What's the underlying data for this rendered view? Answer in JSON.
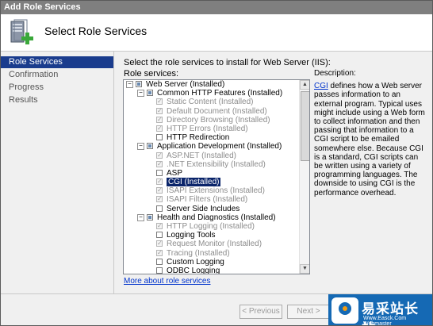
{
  "window": {
    "title": "Add Role Services"
  },
  "header": {
    "title": "Select Role Services",
    "icon": "server-add-icon"
  },
  "sidebar": {
    "items": [
      {
        "label": "Role Services",
        "active": true
      },
      {
        "label": "Confirmation",
        "active": false
      },
      {
        "label": "Progress",
        "active": false
      },
      {
        "label": "Results",
        "active": false
      }
    ]
  },
  "content": {
    "instruction": "Select the role services to install for Web Server (IIS):",
    "role_services_label": "Role services:"
  },
  "tree": {
    "rows": [
      {
        "label": "Web Server  (Installed)",
        "level": 0,
        "expander": "−",
        "check": "partial",
        "disabled": false,
        "selected": false
      },
      {
        "label": "Common HTTP Features  (Installed)",
        "level": 1,
        "expander": "−",
        "check": "partial",
        "disabled": false,
        "selected": false
      },
      {
        "label": "Static Content  (Installed)",
        "level": 2,
        "expander": "",
        "check": "checked",
        "disabled": true,
        "selected": false
      },
      {
        "label": "Default Document  (Installed)",
        "level": 2,
        "expander": "",
        "check": "checked",
        "disabled": true,
        "selected": false
      },
      {
        "label": "Directory Browsing  (Installed)",
        "level": 2,
        "expander": "",
        "check": "checked",
        "disabled": true,
        "selected": false
      },
      {
        "label": "HTTP Errors  (Installed)",
        "level": 2,
        "expander": "",
        "check": "checked",
        "disabled": true,
        "selected": false
      },
      {
        "label": "HTTP Redirection",
        "level": 2,
        "expander": "",
        "check": "unchecked",
        "disabled": false,
        "selected": false
      },
      {
        "label": "Application Development  (Installed)",
        "level": 1,
        "expander": "−",
        "check": "partial",
        "disabled": false,
        "selected": false
      },
      {
        "label": "ASP.NET  (Installed)",
        "level": 2,
        "expander": "",
        "check": "checked",
        "disabled": true,
        "selected": false
      },
      {
        "label": ".NET Extensibility  (Installed)",
        "level": 2,
        "expander": "",
        "check": "checked",
        "disabled": true,
        "selected": false
      },
      {
        "label": "ASP",
        "level": 2,
        "expander": "",
        "check": "unchecked",
        "disabled": false,
        "selected": false
      },
      {
        "label": "CGI  (Installed)",
        "level": 2,
        "expander": "",
        "check": "checked",
        "disabled": true,
        "selected": true
      },
      {
        "label": "ISAPI Extensions  (Installed)",
        "level": 2,
        "expander": "",
        "check": "checked",
        "disabled": true,
        "selected": false
      },
      {
        "label": "ISAPI Filters  (Installed)",
        "level": 2,
        "expander": "",
        "check": "checked",
        "disabled": true,
        "selected": false
      },
      {
        "label": "Server Side Includes",
        "level": 2,
        "expander": "",
        "check": "unchecked",
        "disabled": false,
        "selected": false
      },
      {
        "label": "Health and Diagnostics  (Installed)",
        "level": 1,
        "expander": "−",
        "check": "partial",
        "disabled": false,
        "selected": false
      },
      {
        "label": "HTTP Logging  (Installed)",
        "level": 2,
        "expander": "",
        "check": "checked",
        "disabled": true,
        "selected": false
      },
      {
        "label": "Logging Tools",
        "level": 2,
        "expander": "",
        "check": "unchecked",
        "disabled": false,
        "selected": false
      },
      {
        "label": "Request Monitor  (Installed)",
        "level": 2,
        "expander": "",
        "check": "checked",
        "disabled": true,
        "selected": false
      },
      {
        "label": "Tracing  (Installed)",
        "level": 2,
        "expander": "",
        "check": "checked",
        "disabled": true,
        "selected": false
      },
      {
        "label": "Custom Logging",
        "level": 2,
        "expander": "",
        "check": "unchecked",
        "disabled": false,
        "selected": false
      },
      {
        "label": "ODBC Logging",
        "level": 2,
        "expander": "",
        "check": "unchecked",
        "disabled": false,
        "selected": false
      }
    ]
  },
  "description": {
    "heading": "Description:",
    "link_text": "CGI",
    "text": " defines how a Web server passes information to an external program. Typical uses might include using a Web form to collect information and then passing that information to a CGI script to be emailed somewhere else. Because CGI is a standard, CGI scripts can be written using a variety of programming languages. The downside to using CGI is the performance overhead."
  },
  "more_link": "More about role services",
  "buttons": {
    "previous": "< Previous",
    "next": "Next >"
  },
  "watermark": {
    "text": "易采站长站",
    "sub": "Www.Easck.Com Webmaster"
  },
  "colors": {
    "accent": "#1a3c8d",
    "selection": "#0a246a",
    "link": "#0033cc",
    "watermark_bg": "#1569b4"
  }
}
